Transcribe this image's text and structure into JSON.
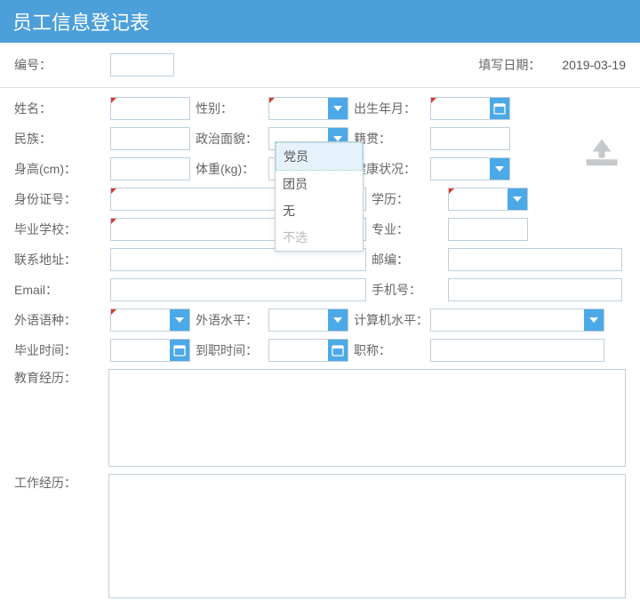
{
  "title": "员工信息登记表",
  "header": {
    "id_label": "编号：",
    "id_value": "",
    "date_label": "填写日期：",
    "date_value": "2019-03-19"
  },
  "labels": {
    "name": "姓名：",
    "gender": "性别：",
    "birth": "出生年月：",
    "ethnic": "民族：",
    "politics": "政治面貌：",
    "native": "籍贯：",
    "height": "身高(cm)：",
    "weight": "体重(kg)：",
    "health": "健康状况：",
    "idnum": "身份证号：",
    "edu": "学历：",
    "gradschool": "毕业学校：",
    "major": "专业：",
    "address": "联系地址：",
    "zipcode": "邮编：",
    "email": "Email：",
    "mobile": "手机号：",
    "lang": "外语语种：",
    "langlvl": "外语水平：",
    "computer": "计算机水平：",
    "gradtime": "毕业时间：",
    "jointime": "到职时间：",
    "jobtitle": "职称：",
    "eduexp": "教育经历：",
    "workexp": "工作经历："
  },
  "politics_options": {
    "opt1": "党员",
    "opt2": "团员",
    "opt3": "无",
    "opt_none": "不选"
  }
}
